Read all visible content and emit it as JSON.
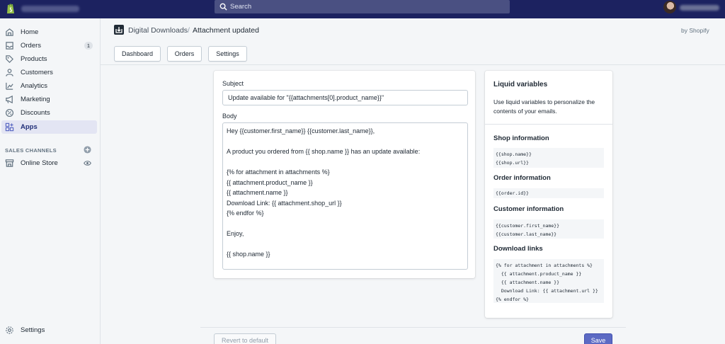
{
  "topbar": {
    "search_placeholder": "Search"
  },
  "sidebar": {
    "items": [
      {
        "label": "Home",
        "icon": "home-icon"
      },
      {
        "label": "Orders",
        "icon": "orders-icon",
        "badge": "1"
      },
      {
        "label": "Products",
        "icon": "tag-icon"
      },
      {
        "label": "Customers",
        "icon": "person-icon"
      },
      {
        "label": "Analytics",
        "icon": "analytics-icon"
      },
      {
        "label": "Marketing",
        "icon": "megaphone-icon"
      },
      {
        "label": "Discounts",
        "icon": "discount-icon"
      },
      {
        "label": "Apps",
        "icon": "apps-icon",
        "active": true
      }
    ],
    "sales_channels_title": "SALES CHANNELS",
    "online_store": "Online Store",
    "settings": "Settings"
  },
  "header": {
    "app_name": "Digital Downloads",
    "separator": "/",
    "page_title": "Attachment updated",
    "by": "by Shopify"
  },
  "tabs": [
    "Dashboard",
    "Orders",
    "Settings"
  ],
  "editor": {
    "subject_label": "Subject",
    "subject_value": "Update available for \"{{attachments[0].product_name}}\"",
    "body_label": "Body",
    "body_lines": [
      "Hey {{customer.first_name}} {{customer.last_name}},",
      "",
      "A product you ordered from {{ shop.name }} has an update available:",
      "",
      "{% for attachment in attachments %}",
      "{{ attachment.product_name }}",
      "{{ attachment.name }}",
      "Download Link: {{ attachment.shop_url }}",
      "{% endfor %}",
      "",
      "Enjoy,",
      "",
      "{{ shop.name }}"
    ]
  },
  "vars": {
    "title": "Liquid variables",
    "description": "Use liquid variables to personalize the contents of your emails.",
    "sections": [
      {
        "heading": "Shop information",
        "code": "{{shop.name}}\n{{shop.url}}"
      },
      {
        "heading": "Order information",
        "code": "{{order.id}}"
      },
      {
        "heading": "Customer information",
        "code": "{{customer.first_name}}\n{{customer.last_name}}"
      },
      {
        "heading": "Download links",
        "code": "{% for attachment in attachments %}\n  {{ attachment.product_name }}\n  {{ attachment.name }}\n  Download Link: {{ attachment.url }}\n{% endfor %}"
      }
    ]
  },
  "footer": {
    "revert_label": "Revert to default",
    "save_label": "Save"
  },
  "colors": {
    "topbar": "#1c2260",
    "primary": "#5c6ac4",
    "logo": "#95bf47"
  }
}
